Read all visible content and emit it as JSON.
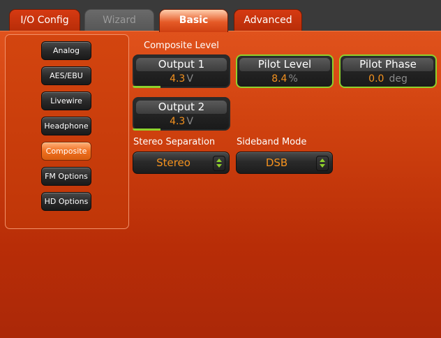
{
  "tabs": [
    {
      "label": "I/O Config"
    },
    {
      "label": "Wizard"
    },
    {
      "label": "Basic"
    },
    {
      "label": "Advanced"
    }
  ],
  "nav": [
    {
      "label": "Analog"
    },
    {
      "label": "AES/EBU"
    },
    {
      "label": "Livewire"
    },
    {
      "label": "Headphone"
    },
    {
      "label": "Composite"
    },
    {
      "label": "FM Options"
    },
    {
      "label": "HD Options"
    }
  ],
  "composite_level_heading": "Composite Level",
  "controls": {
    "output1": {
      "label": "Output 1",
      "value": "4.3",
      "unit": "V"
    },
    "pilot_level": {
      "label": "Pilot Level",
      "value": "8.4",
      "unit": "%"
    },
    "pilot_phase": {
      "label": "Pilot Phase",
      "value": "0.0",
      "unit": "deg"
    },
    "output2": {
      "label": "Output 2",
      "value": "4.3",
      "unit": "V"
    }
  },
  "stereo_separation": {
    "label": "Stereo Separation",
    "value": "Stereo"
  },
  "sideband_mode": {
    "label": "Sideband Mode",
    "value": "DSB"
  },
  "colors": {
    "accent": "#f5921e",
    "active_tab": "#e55a27",
    "indicator": "#8fd12c"
  }
}
